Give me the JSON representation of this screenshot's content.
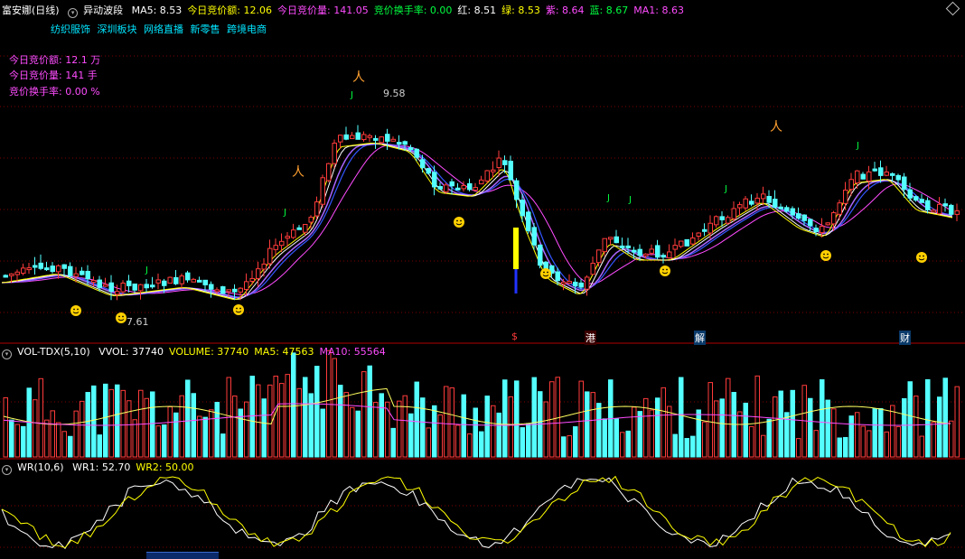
{
  "header": {
    "stock_name": "富安娜(日线)",
    "indicator": "异动波段",
    "items": [
      {
        "label": "MA5: ",
        "value": "8.53",
        "color": "#ffffff"
      },
      {
        "label": "今日竞价额: ",
        "value": "12.06",
        "color": "#ffff00"
      },
      {
        "label": "今日竞价量: ",
        "value": "141.05",
        "color": "#ff4cff"
      },
      {
        "label": "竞价换手率: ",
        "value": "0.00",
        "color": "#00ff40"
      },
      {
        "label": "红: ",
        "value": "8.51",
        "color": "#ffffff"
      },
      {
        "label": "绿: ",
        "value": "8.53",
        "color": "#ffff00"
      },
      {
        "label": "紫: ",
        "value": "8.64",
        "color": "#ff4cff"
      },
      {
        "label": "蓝: ",
        "value": "8.67",
        "color": "#00ff40"
      },
      {
        "label": "MA1: ",
        "value": "8.63",
        "color": "#ff4cff"
      }
    ]
  },
  "sectors": [
    "纺织服饰",
    "深圳板块",
    "网络直播",
    "新零售",
    "跨境电商"
  ],
  "info_lines": [
    {
      "label": "今日竞价额: ",
      "value": "12.1 万"
    },
    {
      "label": "今日竞价量: ",
      "value": "141 手"
    },
    {
      "label": "竞价换手率: ",
      "value": "0.00 %"
    }
  ],
  "price_labels": {
    "high": "9.58",
    "low": "7.61"
  },
  "event_tags": [
    "$",
    "港",
    "解",
    "财"
  ],
  "vol_header": {
    "name": "VOL-TDX(5,10)",
    "items": [
      {
        "label": "VVOL: ",
        "value": "37740",
        "color": "#ffffff"
      },
      {
        "label": "VOLUME: ",
        "value": "37740",
        "color": "#ffff00"
      },
      {
        "label": "MA5: ",
        "value": "47563",
        "color": "#ffff00"
      },
      {
        "label": "MA10: ",
        "value": "55564",
        "color": "#ff4cff"
      }
    ]
  },
  "wr_header": {
    "name": "WR(10,6)",
    "items": [
      {
        "label": "WR1: ",
        "value": "52.70",
        "color": "#ffffff"
      },
      {
        "label": "WR2: ",
        "value": "50.00",
        "color": "#ffff00"
      }
    ]
  },
  "colors": {
    "up": "#ff3b3b",
    "down": "#54ffff",
    "bg": "#000000",
    "grid": "#800000"
  }
}
